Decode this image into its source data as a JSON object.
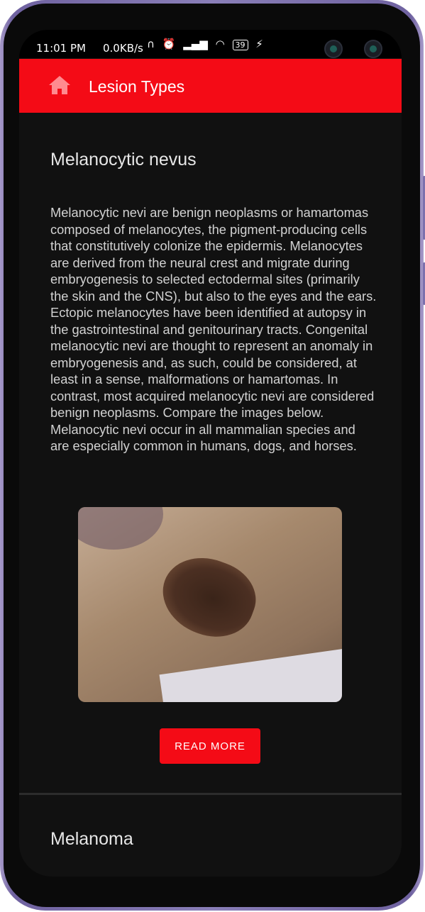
{
  "status_bar": {
    "time": "11:01 PM",
    "speed": "0.0KB/s",
    "battery": "39"
  },
  "appbar": {
    "title": "Lesion Types",
    "home_icon": "home-icon"
  },
  "sections": [
    {
      "title": "Melanocytic nevus",
      "description": "Melanocytic nevi are benign neoplasms or hamartomas composed of melanocytes, the pigment-producing cells that constitutively colonize the epidermis. Melanocytes are derived from the neural crest and migrate during embryogenesis to selected ectodermal sites (primarily the skin and the CNS), but also to the eyes and the ears. Ectopic melanocytes have been identified at autopsy in the gastrointestinal and genitourinary tracts. Congenital melanocytic nevi are thought to represent an anomaly in embryogenesis and, as such, could be considered, at least in a sense, malformations or hamartomas. In contrast, most acquired melanocytic nevi are considered benign neoplasms. Compare the images below. Melanocytic nevi occur in all mammalian species and are especially common in humans, dogs, and horses.",
      "button_label": "READ MORE"
    },
    {
      "title": "Melanoma"
    }
  ],
  "colors": {
    "accent": "#f40b16",
    "background": "#111111"
  }
}
